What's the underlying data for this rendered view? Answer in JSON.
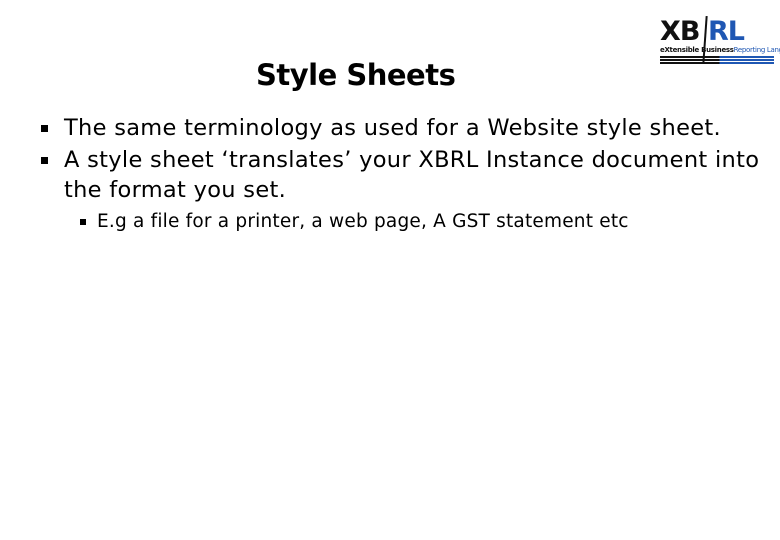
{
  "slide": {
    "title": "Style Sheets",
    "logo": {
      "word_left": "XB",
      "word_right": "RL",
      "tagline_left": "eXtensible Business",
      "tagline_right": "Reporting Language",
      "colors": {
        "dark": "#111111",
        "blue": "#1f57b3"
      }
    },
    "bullets": [
      {
        "text": "The same terminology as used for a Website style sheet."
      },
      {
        "text": "A style sheet ‘translates’ your XBRL Instance document into the format you set."
      }
    ],
    "sub_bullets": [
      {
        "text": "E.g a file for a printer, a web page, A GST statement etc"
      }
    ]
  }
}
